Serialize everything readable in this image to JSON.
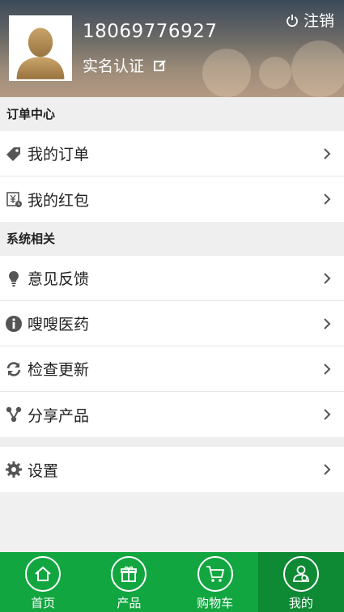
{
  "header": {
    "phone": "18069776927",
    "verify_label": "实名认证",
    "logout_label": "注销"
  },
  "sections": [
    {
      "title": "订单中心",
      "items": [
        {
          "label": "我的订单",
          "icon": "tag-icon"
        },
        {
          "label": "我的红包",
          "icon": "red-packet-icon"
        }
      ]
    },
    {
      "title": "系统相关",
      "items": [
        {
          "label": "意见反馈",
          "icon": "lightbulb-icon"
        },
        {
          "label": "嗖嗖医药",
          "icon": "info-icon"
        },
        {
          "label": "检查更新",
          "icon": "refresh-icon"
        },
        {
          "label": "分享产品",
          "icon": "share-icon"
        }
      ]
    }
  ],
  "settings": {
    "label": "设置",
    "icon": "gear-icon"
  },
  "tabbar": {
    "tabs": [
      {
        "label": "首页",
        "icon": "home-icon"
      },
      {
        "label": "产品",
        "icon": "gift-icon"
      },
      {
        "label": "购物车",
        "icon": "cart-icon"
      },
      {
        "label": "我的",
        "icon": "user-icon"
      }
    ],
    "active_index": 3
  },
  "colors": {
    "accent": "#12a640",
    "accent_active": "#0e8a34",
    "icon_gray": "#555555"
  }
}
